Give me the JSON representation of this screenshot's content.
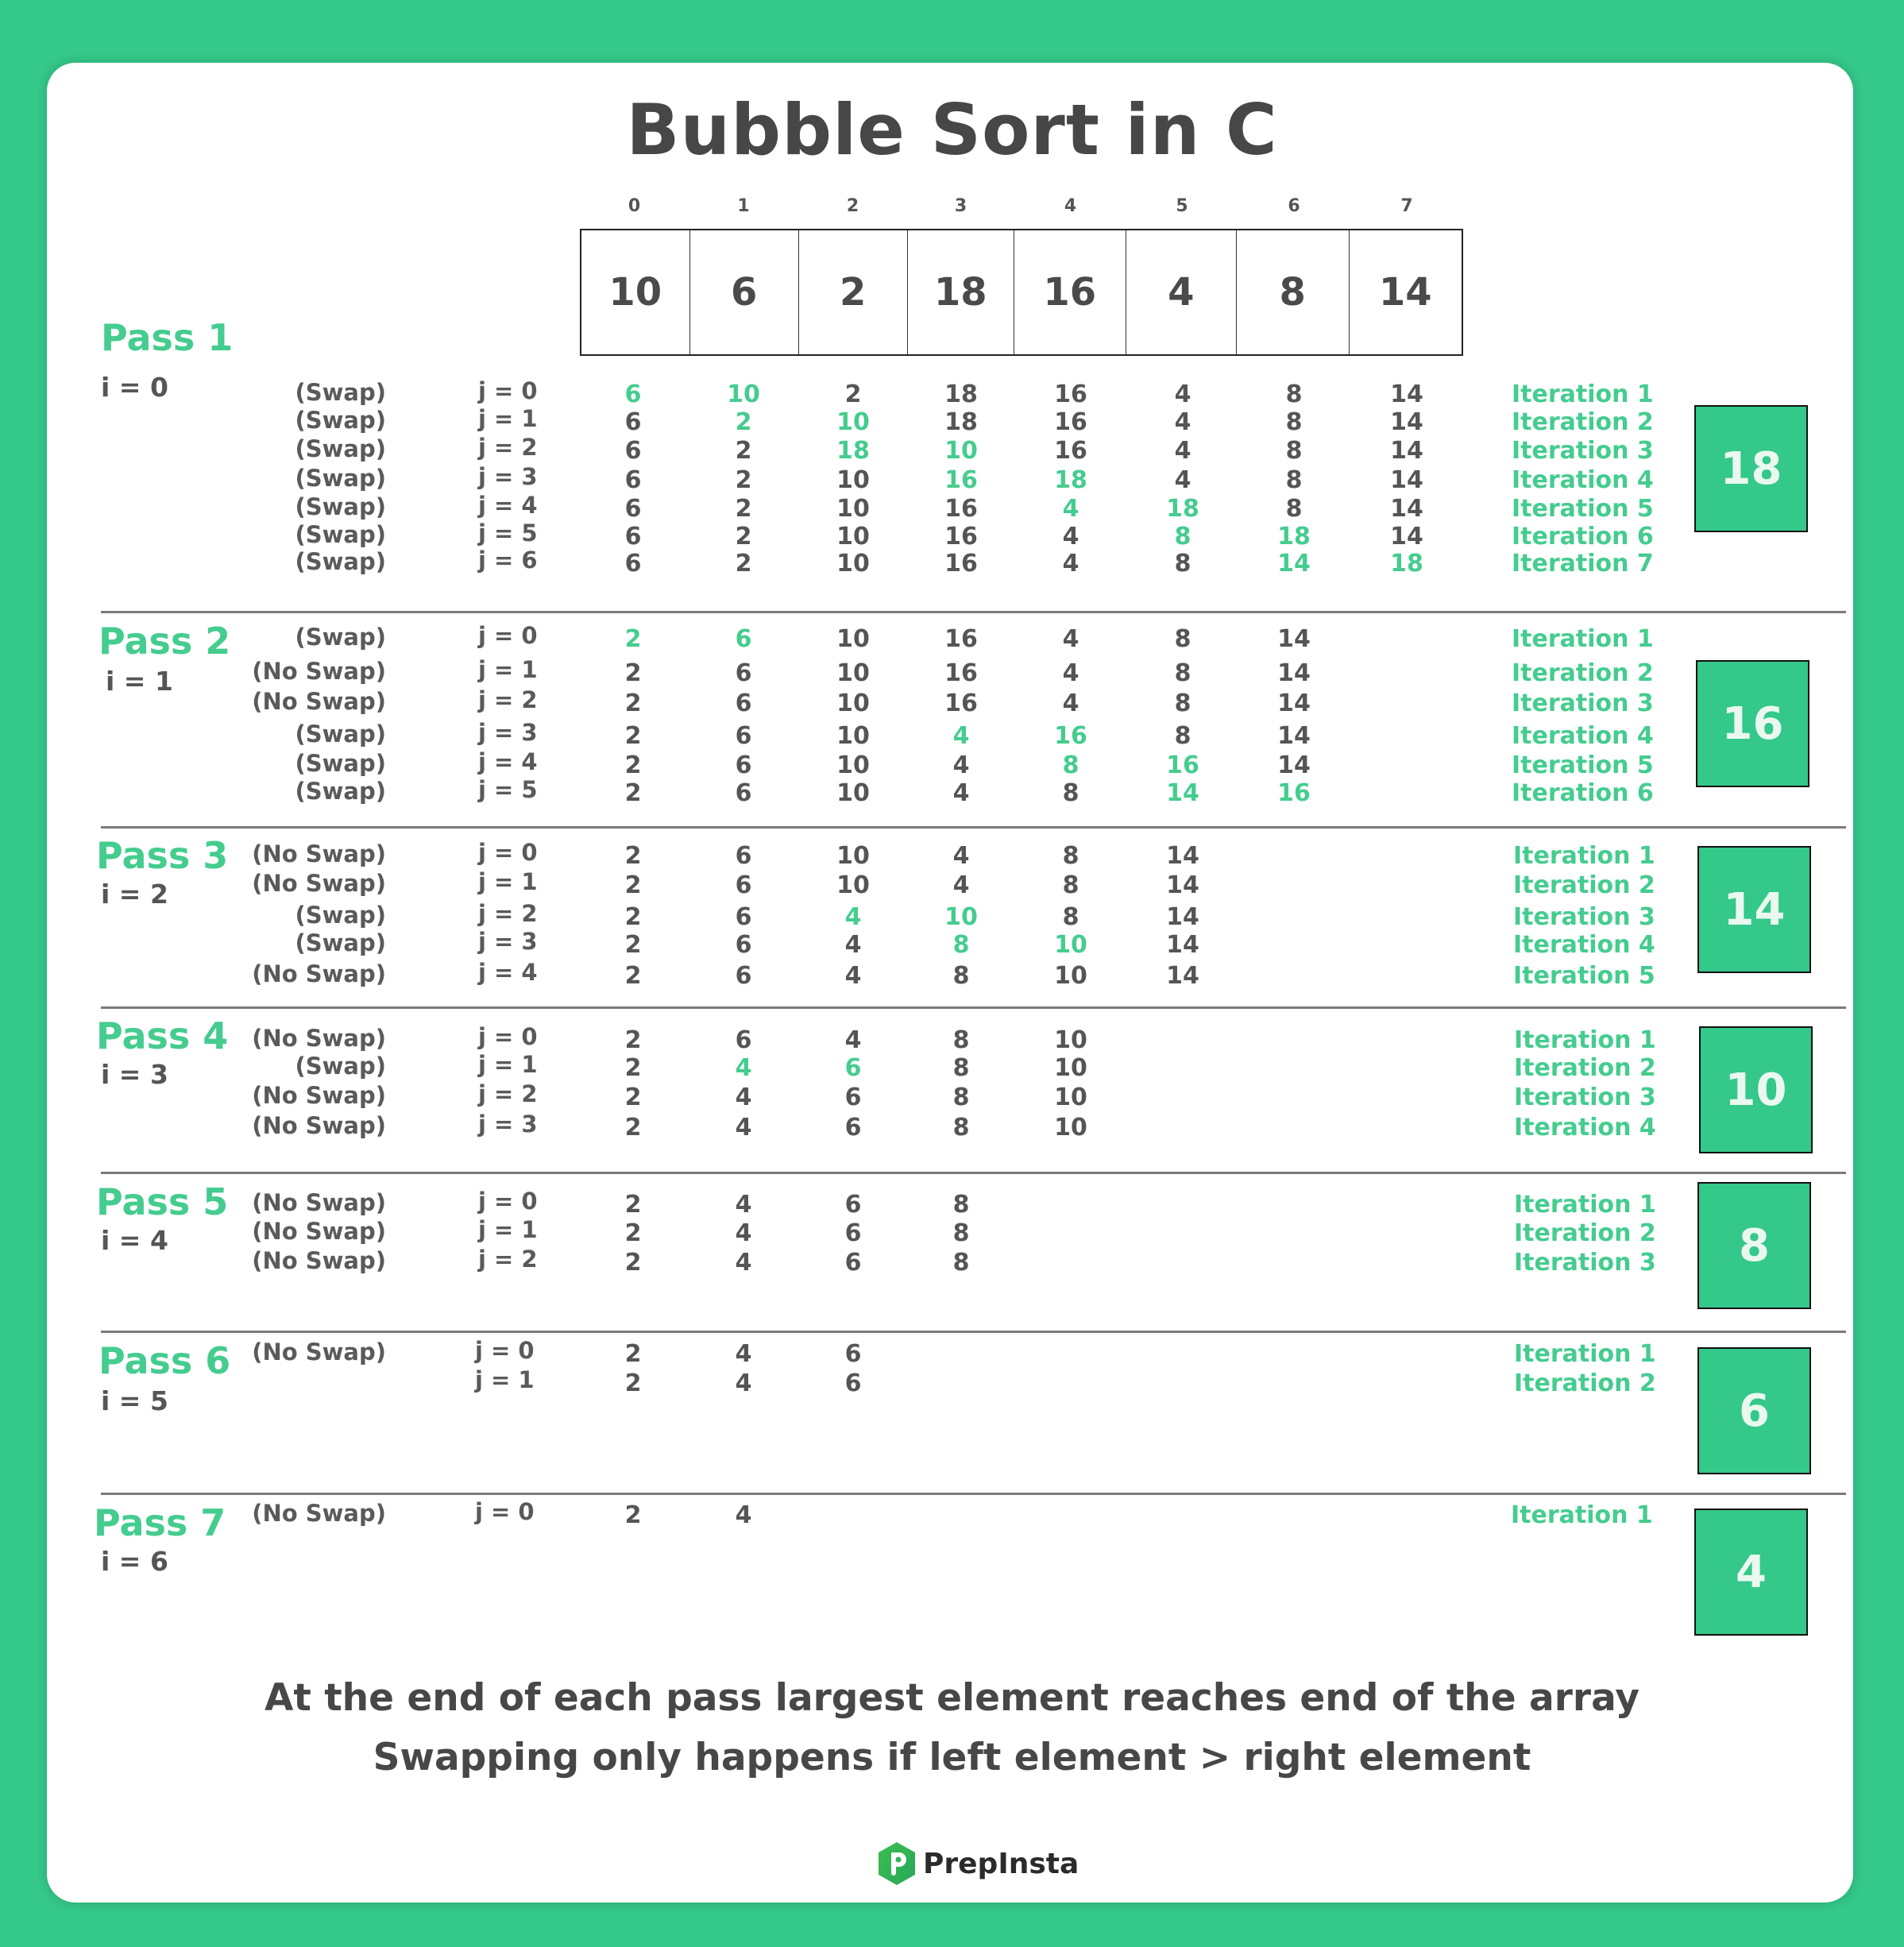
{
  "title": "Bubble Sort in C",
  "array": {
    "indices": [
      "0",
      "1",
      "2",
      "3",
      "4",
      "5",
      "6",
      "7"
    ],
    "values": [
      "10",
      "6",
      "2",
      "18",
      "16",
      "4",
      "8",
      "14"
    ]
  },
  "colors": {
    "accent": "#45CC8F",
    "background": "#34C88A",
    "text": "#474747"
  },
  "passes": [
    {
      "label": "Pass 1",
      "i_label": "i = 0",
      "result": "18",
      "rows": [
        {
          "swap": "(Swap)",
          "j": "j = 0",
          "values": [
            "6",
            "10",
            "2",
            "18",
            "16",
            "4",
            "8",
            "14"
          ],
          "highlight": [
            0,
            1
          ],
          "iteration": "Iteration 1"
        },
        {
          "swap": "(Swap)",
          "j": "j = 1",
          "values": [
            "6",
            "2",
            "10",
            "18",
            "16",
            "4",
            "8",
            "14"
          ],
          "highlight": [
            1,
            2
          ],
          "iteration": "Iteration 2"
        },
        {
          "swap": "(Swap)",
          "j": "j = 2",
          "values": [
            "6",
            "2",
            "18",
            "10",
            "16",
            "4",
            "8",
            "14"
          ],
          "highlight": [
            2,
            3
          ],
          "iteration": "Iteration 3"
        },
        {
          "swap": "(Swap)",
          "j": "j = 3",
          "values": [
            "6",
            "2",
            "10",
            "16",
            "18",
            "4",
            "8",
            "14"
          ],
          "highlight": [
            3,
            4
          ],
          "iteration": "Iteration 4"
        },
        {
          "swap": "(Swap)",
          "j": "j = 4",
          "values": [
            "6",
            "2",
            "10",
            "16",
            "4",
            "18",
            "8",
            "14"
          ],
          "highlight": [
            4,
            5
          ],
          "iteration": "Iteration 5"
        },
        {
          "swap": "(Swap)",
          "j": "j = 5",
          "values": [
            "6",
            "2",
            "10",
            "16",
            "4",
            "8",
            "18",
            "14"
          ],
          "highlight": [
            5,
            6
          ],
          "iteration": "Iteration 6"
        },
        {
          "swap": "(Swap)",
          "j": "j = 6",
          "values": [
            "6",
            "2",
            "10",
            "16",
            "4",
            "8",
            "14",
            "18"
          ],
          "highlight": [
            6,
            7
          ],
          "iteration": "Iteration 7"
        }
      ]
    },
    {
      "label": "Pass 2",
      "i_label": "i = 1",
      "result": "16",
      "rows": [
        {
          "swap": "(Swap)",
          "j": "j = 0",
          "values": [
            "2",
            "6",
            "10",
            "16",
            "4",
            "8",
            "14"
          ],
          "highlight": [
            0,
            1
          ],
          "iteration": "Iteration 1"
        },
        {
          "swap": "(No Swap)",
          "j": "j = 1",
          "values": [
            "2",
            "6",
            "10",
            "16",
            "4",
            "8",
            "14"
          ],
          "highlight": [],
          "iteration": "Iteration 2"
        },
        {
          "swap": "(No Swap)",
          "j": "j = 2",
          "values": [
            "2",
            "6",
            "10",
            "16",
            "4",
            "8",
            "14"
          ],
          "highlight": [],
          "iteration": "Iteration 3"
        },
        {
          "swap": "(Swap)",
          "j": "j = 3",
          "values": [
            "2",
            "6",
            "10",
            "4",
            "16",
            "8",
            "14"
          ],
          "highlight": [
            3,
            4
          ],
          "iteration": "Iteration 4"
        },
        {
          "swap": "(Swap)",
          "j": "j = 4",
          "values": [
            "2",
            "6",
            "10",
            "4",
            "8",
            "16",
            "14"
          ],
          "highlight": [
            4,
            5
          ],
          "iteration": "Iteration 5"
        },
        {
          "swap": "(Swap)",
          "j": "j = 5",
          "values": [
            "2",
            "6",
            "10",
            "4",
            "8",
            "14",
            "16"
          ],
          "highlight": [
            5,
            6
          ],
          "iteration": "Iteration 6"
        }
      ]
    },
    {
      "label": "Pass 3",
      "i_label": "i = 2",
      "result": "14",
      "rows": [
        {
          "swap": "(No Swap)",
          "j": "j = 0",
          "values": [
            "2",
            "6",
            "10",
            "4",
            "8",
            "14"
          ],
          "highlight": [],
          "iteration": "Iteration 1"
        },
        {
          "swap": "(No Swap)",
          "j": "j = 1",
          "values": [
            "2",
            "6",
            "10",
            "4",
            "8",
            "14"
          ],
          "highlight": [],
          "iteration": "Iteration 2"
        },
        {
          "swap": "(Swap)",
          "j": "j = 2",
          "values": [
            "2",
            "6",
            "4",
            "10",
            "8",
            "14"
          ],
          "highlight": [
            2,
            3
          ],
          "iteration": "Iteration 3"
        },
        {
          "swap": "(Swap)",
          "j": "j = 3",
          "values": [
            "2",
            "6",
            "4",
            "8",
            "10",
            "14"
          ],
          "highlight": [
            3,
            4
          ],
          "iteration": "Iteration 4"
        },
        {
          "swap": "(No Swap)",
          "j": "j = 4",
          "values": [
            "2",
            "6",
            "4",
            "8",
            "10",
            "14"
          ],
          "highlight": [],
          "iteration": "Iteration 5"
        }
      ]
    },
    {
      "label": "Pass 4",
      "i_label": "i = 3",
      "result": "10",
      "rows": [
        {
          "swap": "(No Swap)",
          "j": "j = 0",
          "values": [
            "2",
            "6",
            "4",
            "8",
            "10"
          ],
          "highlight": [],
          "iteration": "Iteration 1"
        },
        {
          "swap": "(Swap)",
          "j": "j = 1",
          "values": [
            "2",
            "4",
            "6",
            "8",
            "10"
          ],
          "highlight": [
            1,
            2
          ],
          "iteration": "Iteration 2"
        },
        {
          "swap": "(No Swap)",
          "j": "j = 2",
          "values": [
            "2",
            "4",
            "6",
            "8",
            "10"
          ],
          "highlight": [],
          "iteration": "Iteration 3"
        },
        {
          "swap": "(No Swap)",
          "j": "j = 3",
          "values": [
            "2",
            "4",
            "6",
            "8",
            "10"
          ],
          "highlight": [],
          "iteration": "Iteration 4"
        }
      ]
    },
    {
      "label": "Pass 5",
      "i_label": "i = 4",
      "result": "8",
      "rows": [
        {
          "swap": "(No Swap)",
          "j": "j = 0",
          "values": [
            "2",
            "4",
            "6",
            "8"
          ],
          "highlight": [],
          "iteration": "Iteration 1"
        },
        {
          "swap": "(No Swap)",
          "j": "j = 1",
          "values": [
            "2",
            "4",
            "6",
            "8"
          ],
          "highlight": [],
          "iteration": "Iteration 2"
        },
        {
          "swap": "(No Swap)",
          "j": "j = 2",
          "values": [
            "2",
            "4",
            "6",
            "8"
          ],
          "highlight": [],
          "iteration": "Iteration 3"
        }
      ]
    },
    {
      "label": "Pass 6",
      "i_label": "i = 5",
      "result": "6",
      "rows": [
        {
          "swap": "(No Swap)",
          "j": "j = 0",
          "values": [
            "2",
            "4",
            "6"
          ],
          "highlight": [],
          "iteration": "Iteration 1"
        },
        {
          "swap": "",
          "j": "j = 1",
          "values": [
            "2",
            "4",
            "6"
          ],
          "highlight": [],
          "iteration": "Iteration 2"
        }
      ]
    },
    {
      "label": "Pass 7",
      "i_label": "i = 6",
      "result": "4",
      "rows": [
        {
          "swap": "(No Swap)",
          "j": "j = 0",
          "values": [
            "2",
            "4"
          ],
          "highlight": [],
          "iteration": "Iteration 1"
        }
      ]
    }
  ],
  "footer": {
    "line1": "At the end of each pass largest element reaches end of the array",
    "line2": "Swapping only happens if left element > right element"
  },
  "logo": {
    "text": "PrepInsta",
    "icon": "prepinsta-logo-icon"
  }
}
